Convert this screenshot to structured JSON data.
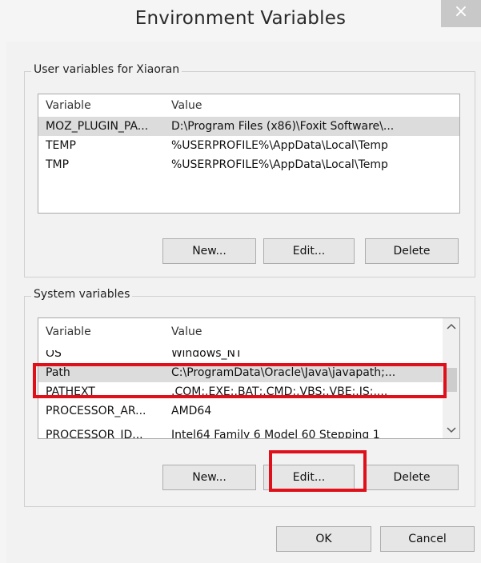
{
  "dialog": {
    "title": "Environment Variables",
    "close_glyph": "×"
  },
  "user_variables": {
    "legend": "User variables for Xiaoran",
    "columns": [
      "Variable",
      "Value"
    ],
    "rows": [
      {
        "variable": "MOZ_PLUGIN_PA...",
        "value": "D:\\Program Files (x86)\\Foxit Software\\..."
      },
      {
        "variable": "TEMP",
        "value": "%USERPROFILE%\\AppData\\Local\\Temp"
      },
      {
        "variable": "TMP",
        "value": "%USERPROFILE%\\AppData\\Local\\Temp"
      }
    ],
    "buttons": {
      "new": "New...",
      "edit": "Edit...",
      "delete": "Delete"
    }
  },
  "system_variables": {
    "legend": "System variables",
    "columns": [
      "Variable",
      "Value"
    ],
    "rows": [
      {
        "variable": "OS",
        "value": "Windows_NT"
      },
      {
        "variable": "Path",
        "value": "C:\\ProgramData\\Oracle\\Java\\javapath;..."
      },
      {
        "variable": "PATHEXT",
        "value": ".COM;.EXE;.BAT;.CMD;.VBS;.VBE;.JS;...."
      },
      {
        "variable": "PROCESSOR_AR...",
        "value": "AMD64"
      },
      {
        "variable": "PROCESSOR_ID...",
        "value": "Intel64 Family 6 Model 60 Stepping 1"
      }
    ],
    "selected_row": "Path",
    "buttons": {
      "new": "New...",
      "edit": "Edit...",
      "delete": "Delete"
    },
    "scrollbar": {
      "up_icon": "chevron-up-icon",
      "down_icon": "chevron-down-icon"
    }
  },
  "footer": {
    "ok": "OK",
    "cancel": "Cancel"
  },
  "colors": {
    "highlight": "#e0101b",
    "selection": "#dcdcdc",
    "dialog_bg": "#f2f2f2"
  }
}
